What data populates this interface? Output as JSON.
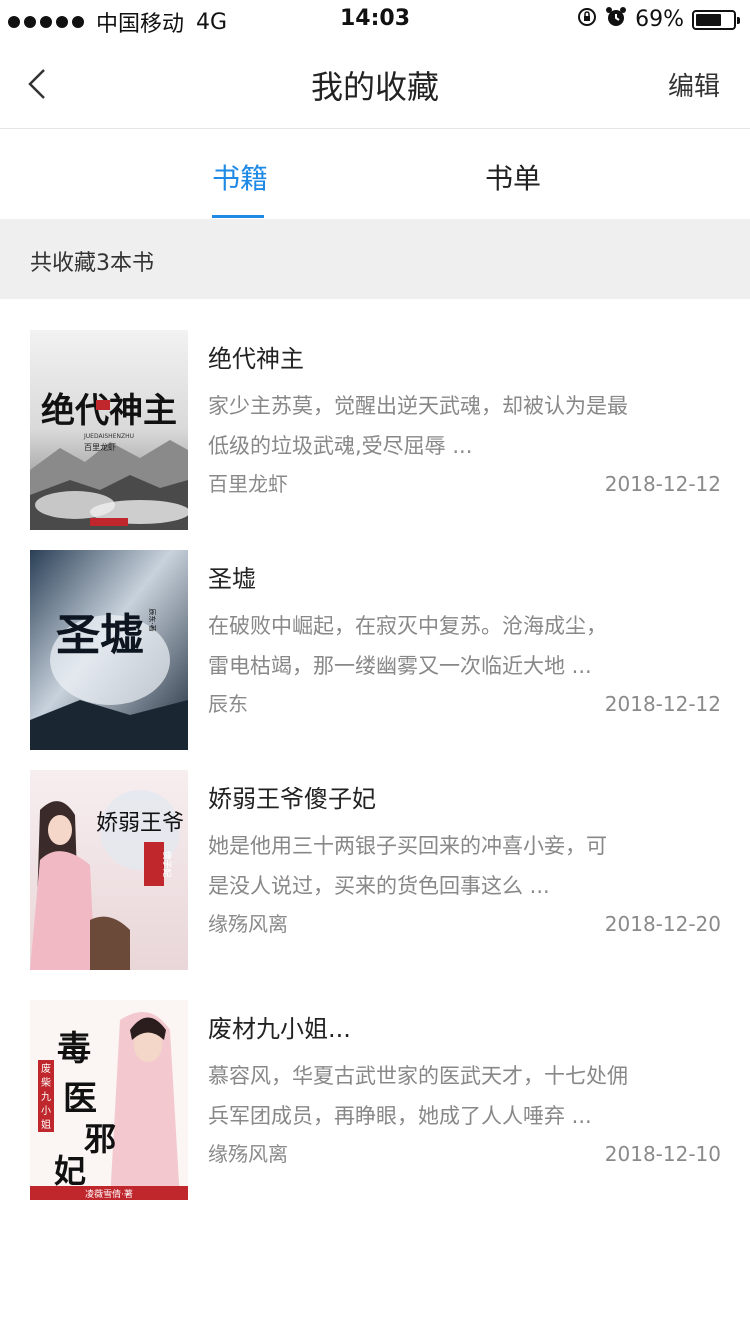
{
  "status_bar": {
    "carrier": "中国移动",
    "network": "4G",
    "time": "14:03",
    "battery_text": "69%",
    "battery_level": 0.69
  },
  "nav": {
    "title": "我的收藏",
    "edit_label": "编辑"
  },
  "tabs": [
    {
      "label": "书籍",
      "active": true
    },
    {
      "label": "书单",
      "active": false
    }
  ],
  "summary": "共收藏3本书",
  "books": [
    {
      "title": "绝代神主",
      "desc_line1": "家少主苏莫，觉醒出逆天武魂，却被认为是最",
      "desc_line2": "低级的垃圾武魂,受尽屈辱 ...",
      "author": "百里龙虾",
      "date": "2018-12-12",
      "cover_text": "绝代神主",
      "cover_sub": "JUEDAISHENZHU",
      "cover_author": "百里龙虾"
    },
    {
      "title": "圣墟",
      "desc_line1": "在破败中崛起，在寂灭中复苏。沧海成尘，",
      "desc_line2": "雷电枯竭，那一缕幽雾又一次临近大地 ...",
      "author": "辰东",
      "date": "2018-12-12",
      "cover_text": "圣墟",
      "cover_author": "辰东·著"
    },
    {
      "title": "娇弱王爷傻子妃",
      "desc_line1": "她是他用三十两银子买回来的冲喜小妾，可",
      "desc_line2": "是没人说过，买来的货色回事这么 ...",
      "author": "缘殇风离",
      "date": "2018-12-20",
      "cover_text": "娇弱王爷",
      "cover_badge": "傻子妃"
    },
    {
      "title": "废材九小姐...",
      "desc_line1": "慕容风，华夏古武世家的医武天才，十七处佣",
      "desc_line2": "兵军团成员，再睁眼，她成了人人唾弃 ...",
      "author": "缘殇风离",
      "date": "2018-12-10",
      "cover_text": "毒医邪妃",
      "cover_badge": "废柴九小姐",
      "cover_author": "凌薇雪倩·著"
    }
  ],
  "colors": {
    "accent": "#1e8ae6",
    "summary_bg": "#efefef",
    "muted_text": "#888888"
  }
}
